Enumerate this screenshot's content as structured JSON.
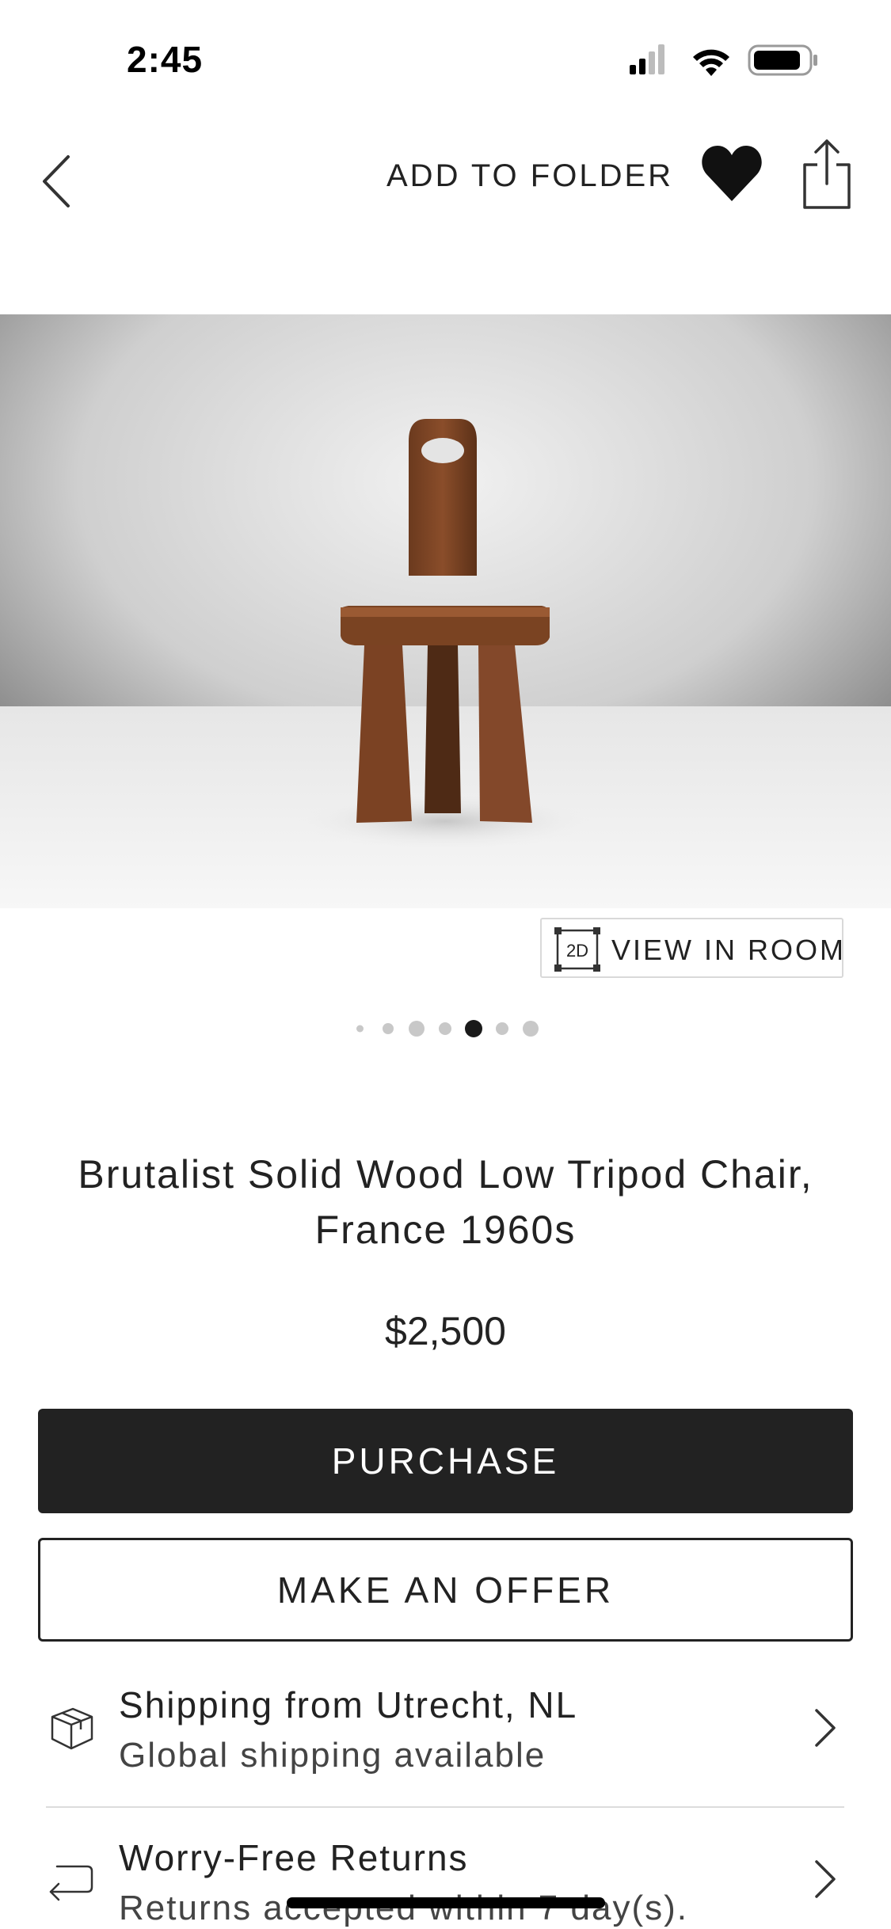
{
  "status_bar": {
    "time": "2:45"
  },
  "nav": {
    "add_to_folder_label": "ADD TO FOLDER",
    "icons": {
      "back": "chevron-left-icon",
      "favorite": "heart-icon",
      "share": "share-icon"
    }
  },
  "gallery": {
    "image_count": 7,
    "active_index": 4,
    "view_in_room_badge": "2D",
    "view_in_room_label": "VIEW IN ROOM"
  },
  "product": {
    "title": "Brutalist Solid Wood Low Tripod Chair, France 1960s",
    "price": "$2,500"
  },
  "actions": {
    "purchase_label": "PURCHASE",
    "offer_label": "MAKE AN OFFER"
  },
  "info_rows": [
    {
      "title": "Shipping from Utrecht, NL",
      "subtitle": "Global shipping available",
      "icon": "package-icon"
    },
    {
      "title": "Worry-Free Returns",
      "subtitle": "Returns accepted within 7 day(s).",
      "icon": "return-arrow-icon"
    }
  ],
  "colors": {
    "primary_button": "#222222",
    "text": "#222222",
    "pager_active": "#1a1a1a",
    "pager_inactive": "#c8c8c8"
  }
}
